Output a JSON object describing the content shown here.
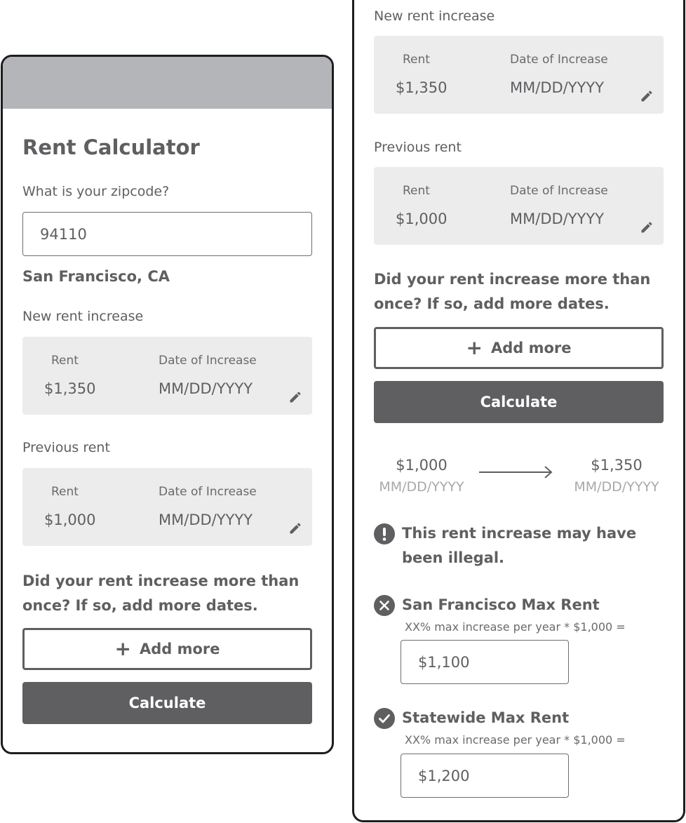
{
  "left": {
    "title": "Rent Calculator",
    "zip_question": "What is your zipcode?",
    "zip_value": "94110",
    "location": "San Francisco, CA",
    "new_rent_section": "New rent increase",
    "new_rent": {
      "rent_label": "Rent",
      "rent_value": "$1,350",
      "date_label": "Date of Increase",
      "date_value": "MM/DD/YYYY"
    },
    "previous_rent_section": "Previous rent",
    "previous_rent": {
      "rent_label": "Rent",
      "rent_value": "$1,000",
      "date_label": "Date of Increase",
      "date_value": "MM/DD/YYYY"
    },
    "more_question_line1": "Did your rent increase more than",
    "more_question_line2": "once? If so, add more dates.",
    "add_more_label": "Add more",
    "add_more_icon": "+",
    "calculate_label": "Calculate"
  },
  "right": {
    "new_rent_section": "New rent increase",
    "new_rent": {
      "rent_label": "Rent",
      "rent_value": "$1,350",
      "date_label": "Date of Increase",
      "date_value": "MM/DD/YYYY"
    },
    "previous_rent_section": "Previous rent",
    "previous_rent": {
      "rent_label": "Rent",
      "rent_value": "$1,000",
      "date_label": "Date of Increase",
      "date_value": "MM/DD/YYYY"
    },
    "more_question_line1": "Did your rent increase more than",
    "more_question_line2": "once? If so, add more dates.",
    "add_more_label": "Add more",
    "add_more_icon": "+",
    "calculate_label": "Calculate",
    "comparison": {
      "from_value": "$1,000",
      "from_date": "MM/DD/YYYY",
      "to_value": "$1,350",
      "to_date": "MM/DD/YYYY"
    },
    "warning_line1": "This rent increase may have",
    "warning_line2": "been illegal.",
    "sf_max": {
      "title": "San Francisco Max Rent",
      "formula": "XX% max increase per year * $1,000 =",
      "value": "$1,100",
      "status": "fail"
    },
    "state_max": {
      "title": "Statewide Max Rent",
      "formula": "XX% max increase per year * $1,000 =",
      "value": "$1,200",
      "status": "pass"
    }
  },
  "icons": {
    "edit": "pencil-icon",
    "warning": "exclamation-icon",
    "fail": "x-circle-icon",
    "pass": "check-circle-icon",
    "arrow": "arrow-right-icon"
  },
  "colors": {
    "primary": "#5f5f62",
    "header": "#b4b5b8",
    "card_bg": "#ececed",
    "muted": "#a9a9ac"
  }
}
